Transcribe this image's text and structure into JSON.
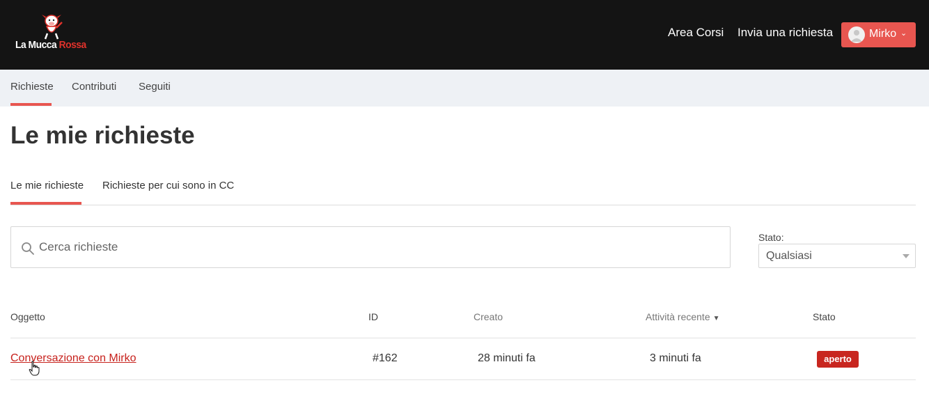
{
  "brand": {
    "logo_text_white": "La Mucca",
    "logo_text_red": "Rossa",
    "primary_color": "#e85650",
    "header_bg": "#141414",
    "badge_color": "#c8261f"
  },
  "header": {
    "nav": [
      "Area Corsi",
      "Invia una richiesta"
    ],
    "user": {
      "name": "Mirko",
      "icon": "chevron-down-icon",
      "avatar_icon": "user-avatar-icon"
    }
  },
  "subnav": {
    "items": [
      "Richieste",
      "Contributi",
      "Seguiti"
    ],
    "active": "Richieste"
  },
  "page": {
    "title": "Le mie richieste"
  },
  "tabs": {
    "items": [
      "Le mie richieste",
      "Richieste per cui sono in CC"
    ],
    "active": "Le mie richieste"
  },
  "search": {
    "placeholder": "Cerca richieste",
    "value": "",
    "icon": "search-icon"
  },
  "filter": {
    "label": "Stato:",
    "selected": "Qualsiasi"
  },
  "table": {
    "columns": [
      "Oggetto",
      "ID",
      "Creato",
      "Attività recente",
      "Stato"
    ],
    "sort_indicator": "▼",
    "rows": [
      {
        "subject": "Conversazione con Mirko",
        "id": "#162",
        "created": "28 minuti fa",
        "activity": "3 minuti fa",
        "status": "aperto"
      }
    ]
  }
}
